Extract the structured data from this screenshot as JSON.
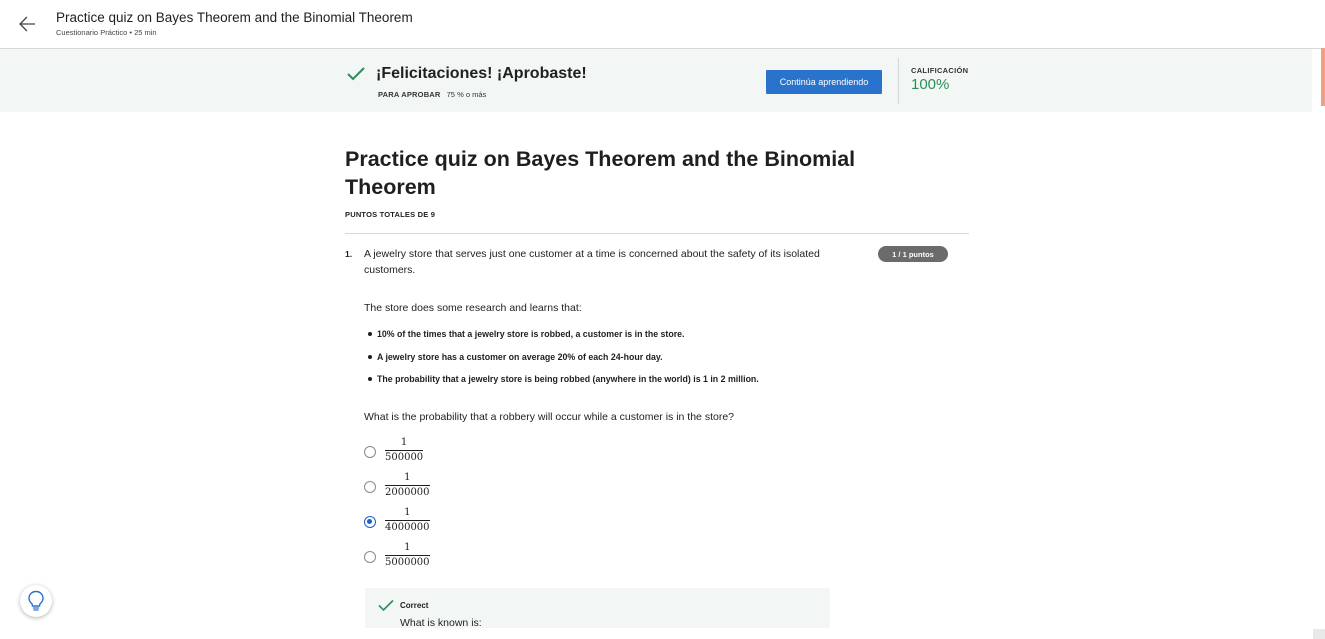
{
  "header": {
    "title": "Practice quiz on Bayes Theorem and the Binomial Theorem",
    "subtitle": "Cuestionario Práctico • 25 min",
    "back_icon": "arrow-left-icon"
  },
  "banner": {
    "message": "¡Felicitaciones! ¡Aprobaste!",
    "pass_label": "PARA APROBAR",
    "pass_value": "75 % o más",
    "continue_button": "Continúa aprendiendo",
    "grade_label": "CALIFICACIÓN",
    "grade_value": "100%",
    "accent_color": "#2a8f5a",
    "button_color": "#2a73cc"
  },
  "quiz": {
    "title": "Practice quiz on Bayes Theorem and the Binomial Theorem",
    "total_points": "PUNTOS TOTALES DE 9"
  },
  "question": {
    "number": "1.",
    "text": "A jewelry store that serves just one customer at a time is concerned about the safety of its isolated customers.",
    "points": "1 / 1 puntos",
    "intro": "The store does some research and learns that:",
    "facts": [
      "10% of the times that a jewelry store is robbed, a customer is in the store.",
      "A jewelry store has a customer on average 20% of each 24-hour day.",
      "The probability that a jewelry store is being robbed (anywhere in the world) is 1 in 2 million."
    ],
    "ask": "What is the probability that a robbery will occur while a customer is in the store?",
    "options": [
      {
        "num": "1",
        "den": "500000",
        "selected": false
      },
      {
        "num": "1",
        "den": "2000000",
        "selected": false
      },
      {
        "num": "1",
        "den": "4000000",
        "selected": true
      },
      {
        "num": "1",
        "den": "5000000",
        "selected": false
      }
    ],
    "feedback_label": "Correct",
    "feedback_text": "What is known is:"
  },
  "help": {
    "icon": "lightbulb-icon"
  }
}
